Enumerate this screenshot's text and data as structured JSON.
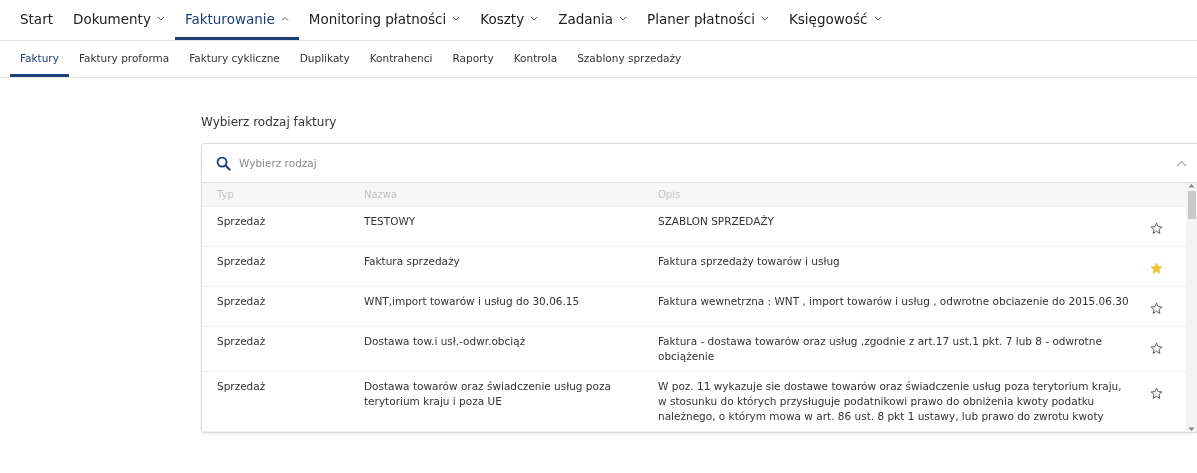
{
  "main_nav": [
    {
      "label": "Start",
      "selected": false
    },
    {
      "label": "Dokumenty",
      "expanded": false,
      "selected": false
    },
    {
      "label": "Fakturowanie",
      "expanded": true,
      "selected": true
    },
    {
      "label": "Monitoring płatności",
      "expanded": false,
      "selected": false
    },
    {
      "label": "Koszty",
      "expanded": false,
      "selected": false
    },
    {
      "label": "Zadania",
      "expanded": false,
      "selected": false
    },
    {
      "label": "Planer płatności",
      "expanded": false,
      "selected": false
    },
    {
      "label": "Księgowość",
      "expanded": false,
      "selected": false
    }
  ],
  "sub_nav": [
    {
      "label": "Faktury",
      "selected": true
    },
    {
      "label": "Faktury proforma",
      "selected": false
    },
    {
      "label": "Faktury cykliczne",
      "selected": false
    },
    {
      "label": "Duplikaty",
      "selected": false
    },
    {
      "label": "Kontrahenci",
      "selected": false
    },
    {
      "label": "Raporty",
      "selected": false
    },
    {
      "label": "Kontrola",
      "selected": false
    },
    {
      "label": "Szablony sprzedaży",
      "selected": false
    }
  ],
  "section_title": "Wybierz rodzaj faktury",
  "search": {
    "placeholder": "Wybierz rodzaj",
    "expanded": true
  },
  "table": {
    "columns": [
      "Typ",
      "Nazwa",
      "Opis"
    ],
    "rows": [
      {
        "type": "Sprzedaż",
        "name": "TESTOWY",
        "description": "SZABLON SPRZEDAŻY",
        "starred": false
      },
      {
        "type": "Sprzedaż",
        "name": "Faktura sprzedaży",
        "description": "Faktura sprzedaży towarów i usług",
        "starred": true
      },
      {
        "type": "Sprzedaż",
        "name": "WNT,import towarów i usług do 30.06.15",
        "description": "Faktura wewnetrzna : WNT , import towarów i usług , odwrotne obciazenie do 2015.06.30",
        "starred": false
      },
      {
        "type": "Sprzedaż",
        "name": "Dostawa tow.i usł.-odwr.obciąż",
        "description": "Faktura - dostawa towarów oraz usług ,zgodnie z art.17 ust.1 pkt. 7 lub 8 - odwrotne obciążenie",
        "starred": false
      },
      {
        "type": "Sprzedaż",
        "name": "Dostawa towarów oraz świadczenie usług poza terytorium kraju i poza UE",
        "description": "W poz. 11 wykazuje sie dostawe towarów oraz świadczenie usług poza terytorium kraju, w stosunku do których przysługuje podatnikowi prawo do obniżenia kwoty podatku należnego, o którym mowa w art. 86 ust. 8 pkt 1 ustawy, lub prawo do zwrotu kwoty",
        "starred": false
      }
    ]
  }
}
